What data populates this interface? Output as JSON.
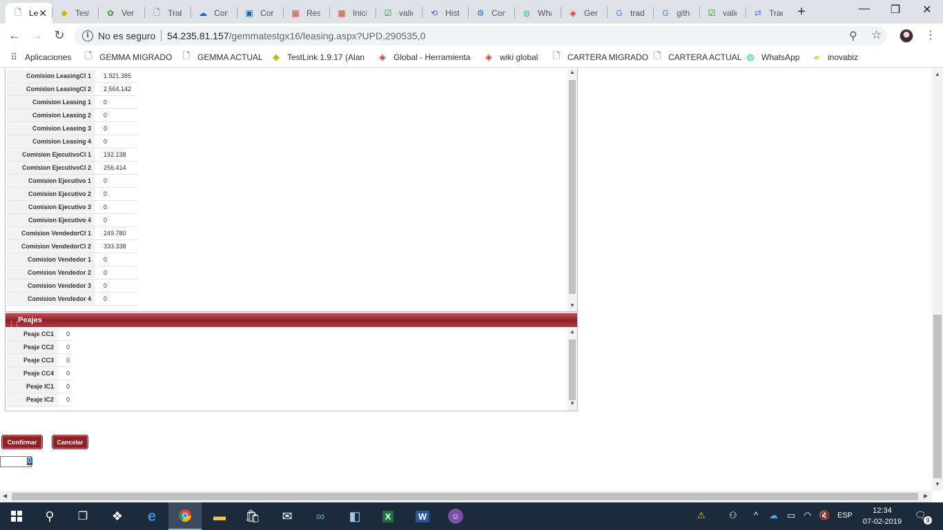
{
  "browser": {
    "tabs": [
      {
        "title": "Le",
        "icon": "page-icon",
        "active": true
      },
      {
        "title": "TestL",
        "icon": "testlink-icon"
      },
      {
        "title": "Ver ir",
        "icon": "bug-icon"
      },
      {
        "title": "Traba",
        "icon": "page-icon"
      },
      {
        "title": "Comp",
        "icon": "onedrive-icon"
      },
      {
        "title": "Corre",
        "icon": "outlook-icon"
      },
      {
        "title": "Resu",
        "icon": "microsoft-icon"
      },
      {
        "title": "Inicia",
        "icon": "microsoft-icon"
      },
      {
        "title": "valid",
        "icon": "checkbox-icon"
      },
      {
        "title": "Histo",
        "icon": "history-icon"
      },
      {
        "title": "Confi",
        "icon": "gear-icon"
      },
      {
        "title": "What",
        "icon": "whatsapp-icon"
      },
      {
        "title": "Gem",
        "icon": "globe-icon"
      },
      {
        "title": "tradu",
        "icon": "google-icon"
      },
      {
        "title": "githu",
        "icon": "google-icon"
      },
      {
        "title": "valid",
        "icon": "checkbox-icon"
      },
      {
        "title": "Tradu",
        "icon": "translate-icon"
      }
    ],
    "security_label": "No es seguro",
    "url_host": "54.235.81.157",
    "url_path": "/gemmatestgx16/leasing.aspx?UPD,290535,0",
    "bookmarks": [
      {
        "label": "Aplicaciones",
        "icon": "apps-grid-icon"
      },
      {
        "label": "GEMMA MIGRADO",
        "icon": "page-icon"
      },
      {
        "label": "GEMMA ACTUAL",
        "icon": "page-icon"
      },
      {
        "label": "TestLink 1.9.17 (Alan",
        "icon": "testlink-icon"
      },
      {
        "label": "Global - Herramienta",
        "icon": "globe-icon"
      },
      {
        "label": "wiki global",
        "icon": "globe-icon"
      },
      {
        "label": "CARTERA MIGRADO",
        "icon": "page-icon"
      },
      {
        "label": "CARTERA ACTUAL",
        "icon": "page-icon"
      },
      {
        "label": "WhatsApp",
        "icon": "whatsapp-icon"
      },
      {
        "label": "inovabiz",
        "icon": "folder-icon"
      }
    ]
  },
  "comisiones": {
    "rows": [
      {
        "label": "Comision LeasingCl 1",
        "value": "1.921.385"
      },
      {
        "label": "Comision LeasingCl 2",
        "value": "2.564.142"
      },
      {
        "label": "Comision Leasing 1",
        "value": "0"
      },
      {
        "label": "Comision Leasing 2",
        "value": "0"
      },
      {
        "label": "Comision Leasing 3",
        "value": "0"
      },
      {
        "label": "Comision Leasing 4",
        "value": "0"
      },
      {
        "label": "Comision EjecutivoCl 1",
        "value": "192.138"
      },
      {
        "label": "Comision EjecutivoCl 2",
        "value": "256.414"
      },
      {
        "label": "Comision Ejecutivo 1",
        "value": "0"
      },
      {
        "label": "Comision Ejecutivo 2",
        "value": "0"
      },
      {
        "label": "Comision Ejecutivo 3",
        "value": "0"
      },
      {
        "label": "Comision Ejecutivo 4",
        "value": "0"
      },
      {
        "label": "Comision VendedorCl 1",
        "value": "249.780"
      },
      {
        "label": "Comision VendedorCl 2",
        "value": "333.338"
      },
      {
        "label": "Comision Vendedor 1",
        "value": "0"
      },
      {
        "label": "Comision Vendedor 2",
        "value": "0"
      },
      {
        "label": "Comision Vendedor 3",
        "value": "0"
      },
      {
        "label": "Comision Vendedor 4",
        "value": "0"
      }
    ]
  },
  "peajes": {
    "title": "Peajes",
    "rows": [
      {
        "label": "Peaje CC1",
        "value": "0"
      },
      {
        "label": "Peaje CC2",
        "value": "0"
      },
      {
        "label": "Peaje CC3",
        "value": "0"
      },
      {
        "label": "Peaje CC4",
        "value": "0"
      },
      {
        "label": "Peaje IC1",
        "value": "0"
      },
      {
        "label": "Peaje IC2",
        "value": "0"
      }
    ]
  },
  "actions": {
    "confirm": "Confirmar",
    "cancel": "Cancelar"
  },
  "hidden_field_value": "0",
  "taskbar": {
    "language": "ESP",
    "time": "12:34",
    "date": "07-02-2019",
    "notifications": "9"
  },
  "colors": {
    "panel_header": "#8e2026",
    "button": "#8e2026",
    "taskbar": "#1c2a3a"
  }
}
